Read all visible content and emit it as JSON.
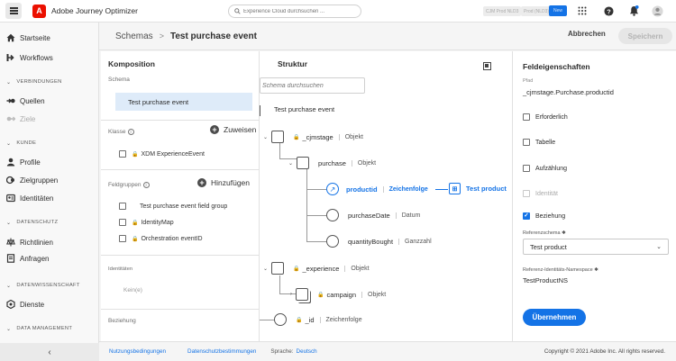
{
  "app": {
    "title": "Adobe Journey Optimizer",
    "logo_letter": "A"
  },
  "search": {
    "placeholder": "Experience Cloud durchsuchen ..."
  },
  "topbar": {
    "env_tag1": "CJM Prod NLD3",
    "env_tag2": "Prod (NLD3)",
    "env_button": "New"
  },
  "nav": {
    "items": [
      {
        "label": "Startseite",
        "icon": "home-icon"
      },
      {
        "label": "Workflows",
        "icon": "workflow-icon"
      }
    ],
    "sections": [
      {
        "title": "VERBINDUNGEN",
        "items": [
          {
            "label": "Quellen",
            "icon": "sources-icon"
          },
          {
            "label": "Ziele",
            "icon": "destinations-icon",
            "disabled": true
          }
        ]
      },
      {
        "title": "KUNDE",
        "items": [
          {
            "label": "Profile",
            "icon": "profile-icon"
          },
          {
            "label": "Zielgruppen",
            "icon": "audience-icon"
          },
          {
            "label": "Identitäten",
            "icon": "identity-icon"
          }
        ]
      },
      {
        "title": "DATENSCHUTZ",
        "items": [
          {
            "label": "Richtlinien",
            "icon": "policy-icon"
          },
          {
            "label": "Anfragen",
            "icon": "requests-icon"
          }
        ]
      },
      {
        "title": "DATENWISSENSCHAFT",
        "items": [
          {
            "label": "Dienste",
            "icon": "services-icon"
          }
        ]
      },
      {
        "title": "DATA MANAGEMENT",
        "items": []
      }
    ]
  },
  "header": {
    "breadcrumb_parent": "Schemas",
    "breadcrumb_sep": ">",
    "title": "Test purchase event",
    "cancel": "Abbrechen",
    "save": "Speichern"
  },
  "composition": {
    "title": "Komposition",
    "schema_label": "Schema",
    "schema_name": "Test purchase event",
    "class_label": "Klasse",
    "assign": "Zuweisen",
    "class_item": "XDM ExperienceEvent",
    "fieldgroups_label": "Feldgruppen",
    "add": "Hinzufügen",
    "fieldgroups": [
      {
        "label": "Test purchase event field group",
        "locked": false
      },
      {
        "label": "IdentityMap",
        "locked": true
      },
      {
        "label": "Orchestration eventID",
        "locked": true
      }
    ],
    "identities_label": "Identitäten",
    "identities_value": "Kein(e)",
    "relation_label": "Beziehung"
  },
  "structure": {
    "title": "Struktur",
    "search_placeholder": "Schema durchsuchen",
    "root": "Test purchase event",
    "nodes": {
      "cjmstage": {
        "name": "_cjmstage",
        "type": "Objekt"
      },
      "purchase": {
        "name": "purchase",
        "type": "Objekt"
      },
      "productid": {
        "name": "productid",
        "type": "Zeichenfolge"
      },
      "purchaseDate": {
        "name": "purchaseDate",
        "type": "Datum"
      },
      "quantityBought": {
        "name": "quantityBought",
        "type": "Ganzzahl"
      },
      "experience": {
        "name": "_experience",
        "type": "Objekt"
      },
      "campaign": {
        "name": "campaign",
        "type": "Objekt"
      },
      "id": {
        "name": "_id",
        "type": "Zeichenfolge"
      }
    },
    "relation_target": "Test product"
  },
  "props": {
    "title": "Feldeigenschaften",
    "path_label": "Pfad",
    "path_value": "_cjmstage.Purchase.productid",
    "required": "Erforderlich",
    "table": "Tabelle",
    "enum": "Aufzählung",
    "identity": "Identität",
    "relation": "Beziehung",
    "ref_schema_label": "Referenzschema",
    "ref_schema_value": "Test product",
    "ref_ns_label": "Referenz-Identitäts-Namespace",
    "ref_ns_value": "TestProductNS",
    "apply": "Übernehmen"
  },
  "footer": {
    "terms": "Nutzungsbedingungen",
    "privacy": "Datenschutzbestimmungen",
    "lang_label": "Sprache:",
    "lang": "Deutsch",
    "copyright": "Copyright © 2021 Adobe Inc. All rights reserved."
  },
  "colors": {
    "accent": "#1473e6",
    "brand": "#eb1000"
  }
}
